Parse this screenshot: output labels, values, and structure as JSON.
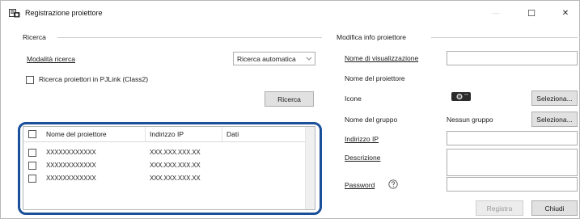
{
  "window": {
    "title": "Registrazione proiettore",
    "min_glyph": "—",
    "max_glyph": "☐",
    "close_glyph": "✕"
  },
  "search": {
    "group_label": "Ricerca",
    "mode_label": "Modalità ricerca",
    "mode_value": "Ricerca automatica",
    "pjlink_checkbox_label": "Ricerca proiettori in PJLink (Class2)",
    "pjlink_checked": false,
    "search_button": "Ricerca"
  },
  "table": {
    "columns": [
      "Nome del proiettore",
      "Indirizzo IP",
      "Dati"
    ],
    "rows": [
      {
        "name": "XXXXXXXXXXXX",
        "ip": "XXX.XXX.XXX.XX",
        "data": ""
      },
      {
        "name": "XXXXXXXXXXXX",
        "ip": "XXX.XXX.XXX.XX",
        "data": ""
      },
      {
        "name": "XXXXXXXXXXXX",
        "ip": "XXX.XXX.XXX.XX",
        "data": ""
      }
    ]
  },
  "edit": {
    "group_label": "Modifica info proiettore",
    "display_name_label": "Nome di visualizzazione",
    "display_name_value": "",
    "projector_name_label": "Nome del proiettore",
    "projector_name_value": "",
    "icons_label": "Icone",
    "icons_button": "Seleziona...",
    "group_name_label": "Nome del gruppo",
    "group_name_value": "Nessun gruppo",
    "group_button": "Seleziona...",
    "ip_label": "Indirizzo IP",
    "ip_value": "",
    "description_label": "Descrizione",
    "description_value": "",
    "password_label": "Password",
    "password_value": "",
    "register_button": "Registra",
    "close_button": "Chiudi"
  }
}
